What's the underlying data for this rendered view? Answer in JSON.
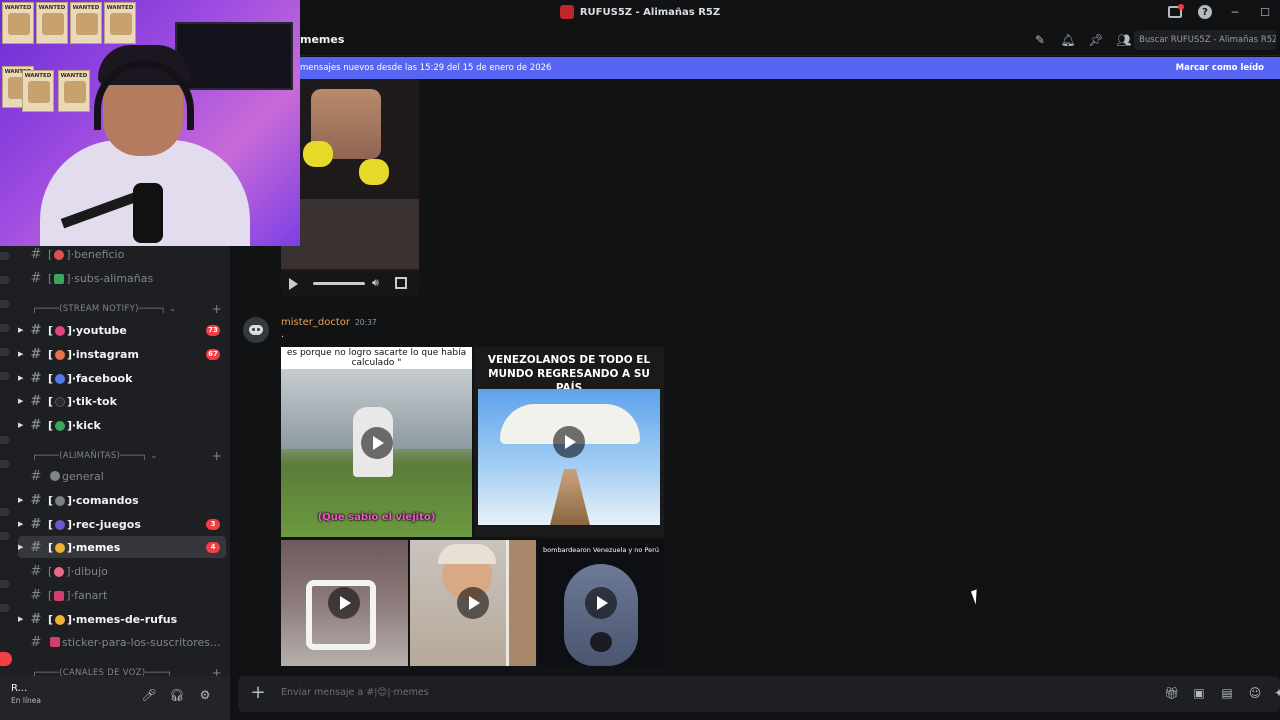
{
  "titlebar": {
    "title": "RUFUS5Z - Alimañas R5Z"
  },
  "header": {
    "channel_name": "memes",
    "search_placeholder": "Buscar RUFUS5Z - Alimañas R5Z"
  },
  "new_messages_bar": {
    "text": "mensajes nuevos desde las 15:29 del 15 de enero de 2026",
    "mark_read": "Marcar como leído"
  },
  "sidebar": {
    "channels_top": [
      {
        "label": "beneficio",
        "emoji_color": "#d9534f"
      },
      {
        "label": "subs-alimañas",
        "emoji_color": "#3ba55c"
      }
    ],
    "category_stream": "(STREAM NOTIFY)",
    "stream_channels": [
      {
        "label": "youtube",
        "emoji_color": "#e0457b",
        "mentions": "73"
      },
      {
        "label": "instagram",
        "emoji_color": "#e8734a",
        "mentions": "67"
      },
      {
        "label": "facebook",
        "emoji_color": "#4f7ce8",
        "mentions": ""
      },
      {
        "label": "tik-tok",
        "emoji_color": "#2b2d31",
        "mentions": ""
      },
      {
        "label": "kick",
        "emoji_color": "#3ba55c",
        "mentions": ""
      }
    ],
    "category_alimanas": "(ALIMAÑITAS)",
    "alimanas_channels": [
      {
        "label": "general",
        "mentions": ""
      },
      {
        "label": "comandos",
        "mentions": ""
      },
      {
        "label": "rec-juegos",
        "mentions": "3"
      },
      {
        "label": "memes",
        "mentions": "4"
      },
      {
        "label": "dibujo",
        "mentions": ""
      },
      {
        "label": "fanart",
        "mentions": ""
      },
      {
        "label": "memes-de-rufus",
        "mentions": ""
      },
      {
        "label": "sticker-para-los-suscritores...",
        "mentions": ""
      }
    ],
    "category_voice": "(CANALES DE VOZ)"
  },
  "user_panel": {
    "name": "R...",
    "status": "En línea"
  },
  "message": {
    "author": "mister_doctor",
    "time": "20:37",
    "text": ".",
    "author_color": "#e8a256"
  },
  "media": {
    "t1_caption_top": "es porque no logro sacarte lo que había calculado \"",
    "t1_caption_bottom": "(Que sabio el viejito)",
    "t2_caption": "VENEZOLANOS DE TODO EL MUNDO REGRESANDO A SU PAÍS",
    "t5_caption": "bombardearon Venezuela y no Perú"
  },
  "composer": {
    "placeholder": "Enviar mensaje a #|😊|‧memes"
  },
  "colors": {
    "accent": "#5865f2",
    "mention": "#f23f43"
  }
}
